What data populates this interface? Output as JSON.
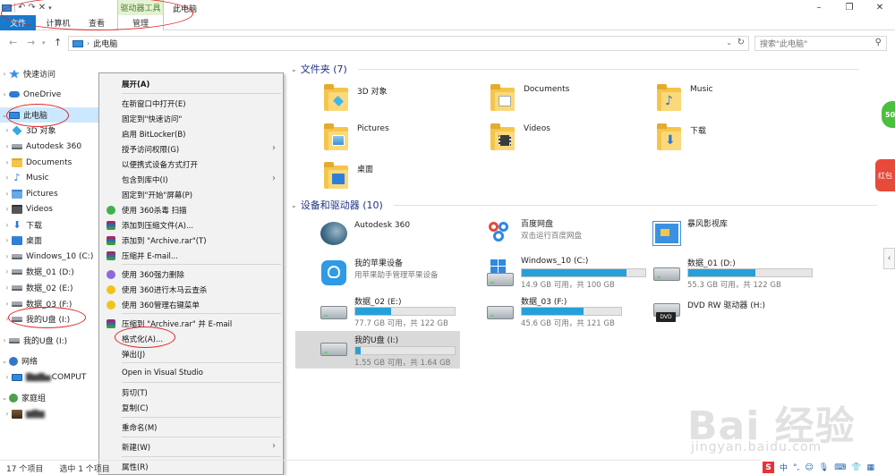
{
  "window": {
    "context_group": "驱动器工具",
    "title": "此电脑"
  },
  "ribbon": {
    "tabs": [
      "文件",
      "计算机",
      "查看",
      "管理"
    ]
  },
  "address": {
    "path": "此电脑",
    "search_placeholder": "搜索\"此电脑\""
  },
  "nav": {
    "items": [
      {
        "label": "快速访问",
        "icon": "star-icon"
      },
      {
        "label": "OneDrive",
        "icon": "cloud-icon"
      },
      {
        "label": "此电脑",
        "icon": "computer-icon"
      },
      {
        "label": "3D 对象",
        "icon": "cube-icon"
      },
      {
        "label": "Autodesk 360",
        "icon": "autodesk-icon"
      },
      {
        "label": "Documents",
        "icon": "folder-icon"
      },
      {
        "label": "Music",
        "icon": "music-icon"
      },
      {
        "label": "Pictures",
        "icon": "pictures-icon"
      },
      {
        "label": "Videos",
        "icon": "videos-icon"
      },
      {
        "label": "下载",
        "icon": "download-icon"
      },
      {
        "label": "桌面",
        "icon": "desktop-icon"
      },
      {
        "label": "Windows_10 (C:)",
        "icon": "drive-icon"
      },
      {
        "label": "数据_01 (D:)",
        "icon": "drive-icon"
      },
      {
        "label": "数据_02 (E:)",
        "icon": "drive-icon"
      },
      {
        "label": "数据_03 (F:)",
        "icon": "drive-icon"
      },
      {
        "label": "我的U盘 (I:)",
        "icon": "usb-drive-icon"
      },
      {
        "label": "我的U盘 (I:)",
        "icon": "usb-drive-icon"
      },
      {
        "label": "网络",
        "icon": "network-icon"
      },
      {
        "label": "COMPUT",
        "icon": "computer-icon"
      },
      {
        "label": "家庭组",
        "icon": "homegroup-icon"
      },
      {
        "label": "",
        "icon": "user-photo-icon"
      }
    ]
  },
  "main": {
    "folders_header": "文件夹 (7)",
    "folders": [
      "3D 对象",
      "Documents",
      "Music",
      "Pictures",
      "Videos",
      "下载",
      "桌面"
    ],
    "devices_header": "设备和驱动器 (10)",
    "devices": [
      {
        "name": "Autodesk 360",
        "sub": ""
      },
      {
        "name": "百度网盘",
        "sub": "双击运行百度网盘"
      },
      {
        "name": "暴风影视库",
        "sub": ""
      },
      {
        "name": "我的苹果设备",
        "sub": "用苹果助手管理苹果设备"
      },
      {
        "name": "Windows_10 (C:)",
        "sub": "14.9 GB 可用，共 100 GB",
        "used": 0.851
      },
      {
        "name": "数据_01 (D:)",
        "sub": "55.3 GB 可用，共 122 GB",
        "used": 0.547
      },
      {
        "name": "数据_02 (E:)",
        "sub": "77.7 GB 可用，共 122 GB",
        "used": 0.363
      },
      {
        "name": "数据_03 (F:)",
        "sub": "45.6 GB 可用，共 121 GB",
        "used": 0.623
      },
      {
        "name": "DVD RW 驱动器 (H:)",
        "sub": ""
      },
      {
        "name": "我的U盘 (I:)",
        "sub": "1.55 GB 可用，共 1.64 GB",
        "used": 0.055
      }
    ]
  },
  "context_menu": {
    "items": [
      {
        "label": "展开(A)",
        "bold": true
      },
      {
        "label": "在新窗口中打开(E)"
      },
      {
        "label": "固定到\"快速访问\""
      },
      {
        "label": "启用 BitLocker(B)"
      },
      {
        "label": "授予访问权限(G)",
        "submenu": true
      },
      {
        "label": "以便携式设备方式打开"
      },
      {
        "label": "包含到库中(I)",
        "submenu": true
      },
      {
        "label": "固定到\"开始\"屏幕(P)"
      },
      {
        "label": "使用 360杀毒 扫描",
        "icon": "360-antivirus-icon"
      },
      {
        "label": "添加到压缩文件(A)...",
        "icon": "winrar-icon"
      },
      {
        "label": "添加到 \"Archive.rar\"(T)",
        "icon": "winrar-icon"
      },
      {
        "label": "压缩并 E-mail...",
        "icon": "winrar-icon"
      },
      {
        "label": "使用 360强力删除",
        "icon": "360-delete-icon"
      },
      {
        "label": "使用 360进行木马云查杀",
        "icon": "360-trojan-icon"
      },
      {
        "label": "使用 360管理右键菜单",
        "icon": "360-menu-icon"
      },
      {
        "label": "压缩到 \"Archive.rar\" 并 E-mail",
        "icon": "winrar-icon"
      },
      {
        "label": "格式化(A)..."
      },
      {
        "label": "弹出(J)"
      },
      {
        "label": "Open in Visual Studio"
      },
      {
        "label": "剪切(T)"
      },
      {
        "label": "复制(C)"
      },
      {
        "label": "重命名(M)"
      },
      {
        "label": "新建(W)",
        "submenu": true
      },
      {
        "label": "属性(R)"
      }
    ]
  },
  "status": {
    "count": "17 个项目",
    "selected": "选中 1 个项目"
  },
  "side_badges": {
    "green": "50",
    "red": "红包"
  },
  "tray": [
    "中",
    "°,",
    "☺",
    "⌨"
  ],
  "watermark": {
    "text": "Bai 经验",
    "url": "jingyan.baidu.com"
  },
  "colors": {
    "accent": "#1979ca",
    "selection": "#cce8ff",
    "drive_bar": "#26a0da",
    "annotation_red": "#e02525"
  }
}
